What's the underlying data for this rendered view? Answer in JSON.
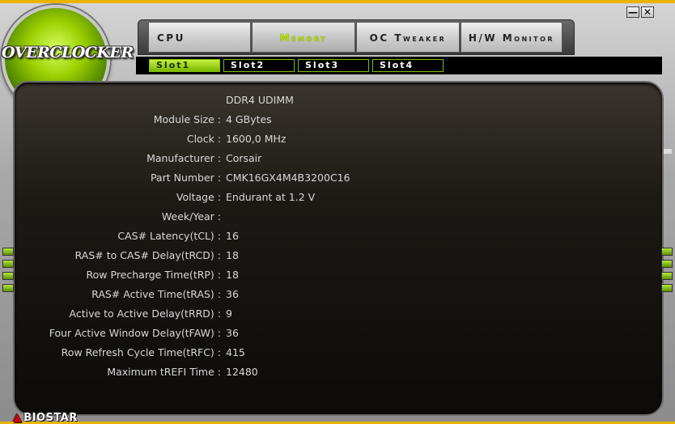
{
  "window": {
    "minimize_glyph": "—",
    "close_glyph": "✕"
  },
  "logo": {
    "text": "OVERCLOCKER"
  },
  "tabs": [
    {
      "id": "cpu",
      "label": "CPU",
      "active": false
    },
    {
      "id": "memory",
      "label": "Memory",
      "active": true
    },
    {
      "id": "oc_tweaker",
      "label": "OC Tweaker",
      "active": false
    },
    {
      "id": "hw_monitor",
      "label": "H/W Monitor",
      "active": false
    }
  ],
  "slots": [
    {
      "label": "Slot1",
      "active": true
    },
    {
      "label": "Slot2",
      "active": false
    },
    {
      "label": "Slot3",
      "active": false
    },
    {
      "label": "Slot4",
      "active": false
    }
  ],
  "memory": {
    "rows": [
      {
        "label": "",
        "value": "DDR4 UDIMM"
      },
      {
        "label": "Module Size :",
        "value": "4 GBytes"
      },
      {
        "label": "Clock :",
        "value": "1600,0 MHz"
      },
      {
        "label": "Manufacturer :",
        "value": "Corsair"
      },
      {
        "label": "Part Number :",
        "value": "CMK16GX4M4B3200C16"
      },
      {
        "label": "Voltage :",
        "value": "Endurant at 1.2 V"
      },
      {
        "label": "Week/Year :",
        "value": ""
      },
      {
        "label": "CAS# Latency(tCL) :",
        "value": "16"
      },
      {
        "label": "RAS# to CAS# Delay(tRCD) :",
        "value": "18"
      },
      {
        "label": "Row Precharge Time(tRP) :",
        "value": "18"
      },
      {
        "label": "RAS# Active Time(tRAS) :",
        "value": "36"
      },
      {
        "label": "Active to Active Delay(tRRD) :",
        "value": "9"
      },
      {
        "label": "Four Active Window Delay(tFAW) :",
        "value": "36"
      },
      {
        "label": "Row Refresh Cycle Time(tRFC) :",
        "value": "415"
      },
      {
        "label": "Maximum tREFI Time :",
        "value": "12480"
      }
    ]
  },
  "brand": {
    "mark": "▲",
    "name": "BIOSTAR"
  },
  "colors": {
    "accent": "#9ad000",
    "background": "#1c1a15",
    "border": "#e8b400"
  }
}
